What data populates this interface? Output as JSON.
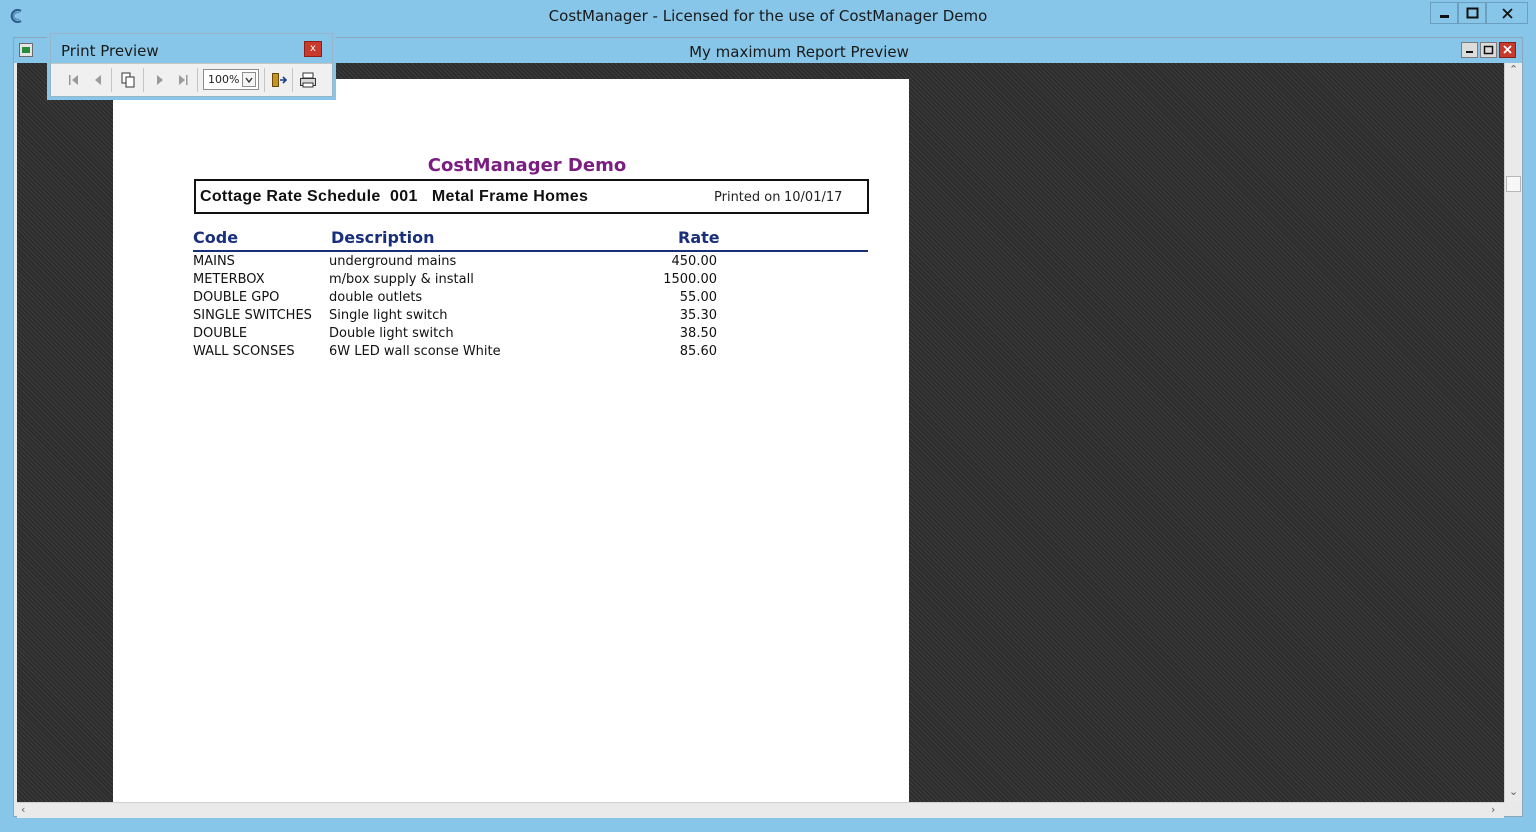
{
  "app": {
    "title": "CostManager - Licensed for the use of CostManager Demo"
  },
  "child_window": {
    "title": "My maximum Report Preview"
  },
  "print_preview": {
    "title": "Print Preview",
    "close_label": "x",
    "zoom": "100%",
    "buttons": [
      "first-page",
      "previous-page",
      "copy",
      "next-page",
      "last-page",
      "exit",
      "print"
    ]
  },
  "report": {
    "company": "CostManager Demo",
    "header_title": "Cottage Rate Schedule  001   Metal Frame Homes",
    "printed_label": "Printed on",
    "printed_date": "10/01/17",
    "columns": {
      "code": "Code",
      "description": "Description",
      "rate": "Rate"
    },
    "rows": [
      {
        "code": "MAINS",
        "description": "underground mains",
        "rate": "450.00"
      },
      {
        "code": "METERBOX",
        "description": "m/box supply & install",
        "rate": "1500.00"
      },
      {
        "code": "DOUBLE GPO",
        "description": "double outlets",
        "rate": "55.00"
      },
      {
        "code": "SINGLE SWITCHES",
        "description": "Single light switch",
        "rate": "35.30"
      },
      {
        "code": "DOUBLE",
        "description": "Double light switch",
        "rate": "38.50"
      },
      {
        "code": "WALL SCONSES",
        "description": "6W LED wall sconse White",
        "rate": "85.60"
      }
    ]
  },
  "colors": {
    "titlebar": "#87c6e8",
    "company": "#7a1f80",
    "column_heading": "#1a2f7a",
    "close_button": "#c73a2c"
  }
}
